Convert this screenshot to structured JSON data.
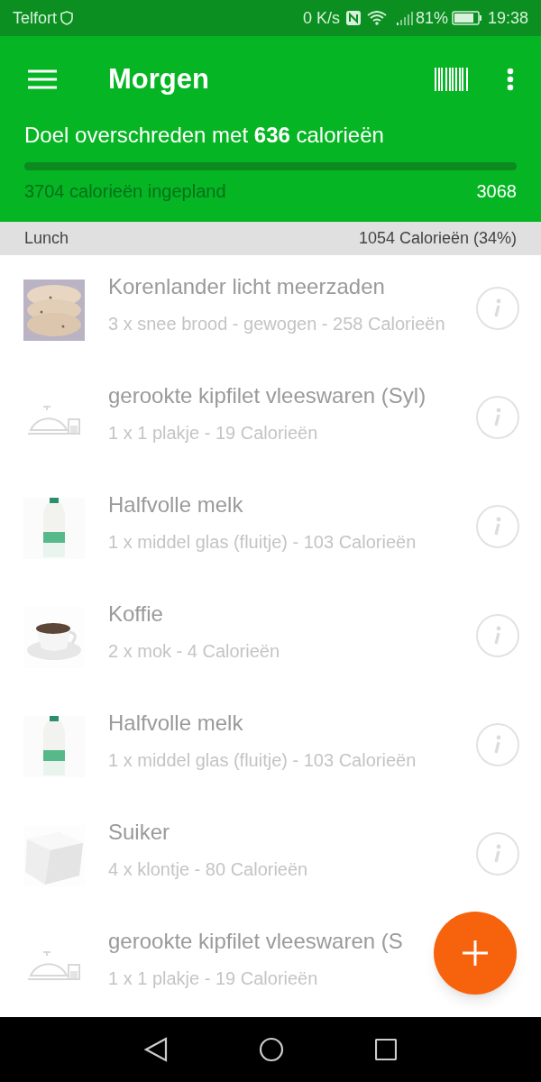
{
  "status_bar": {
    "carrier": "Telfort",
    "speed": "0 K/s",
    "battery": "81%",
    "time": "19:38"
  },
  "toolbar": {
    "title": "Morgen"
  },
  "summary": {
    "goal": "Doel overschreden met **636** calorieën",
    "planned": "3704 calorieën ingepland",
    "target": "3068"
  },
  "section": {
    "name": "Lunch",
    "total": "1054 Calorieën (34%)"
  },
  "items": [
    {
      "kind": "bread",
      "title": "Korenlander licht meerzaden",
      "detail": "3 x snee brood - gewogen - 258 Calorieën",
      "info_button": true
    },
    {
      "kind": "placeholder",
      "title": "gerookte kipfilet vleeswaren (Syl)",
      "detail": "1 x 1 plakje - 19 Calorieën",
      "info_button": true
    },
    {
      "kind": "milk",
      "title": "Halfvolle melk",
      "detail": "1 x middel glas (fluitje) - 103 Calorieën",
      "info_button": true
    },
    {
      "kind": "coffee",
      "title": "Koffie",
      "detail": "2 x mok - 4 Calorieën",
      "info_button": true
    },
    {
      "kind": "milk",
      "title": "Halfvolle melk",
      "detail": "1 x middel glas (fluitje) - 103 Calorieën",
      "info_button": true
    },
    {
      "kind": "sugar",
      "title": "Suiker",
      "detail": "4 x klontje - 80 Calorieën",
      "info_button": true
    },
    {
      "kind": "placeholder",
      "title": "gerookte kipfilet vleeswaren (S",
      "detail": "1 x 1 plakje - 19 Calorieën",
      "info_button": false
    }
  ]
}
